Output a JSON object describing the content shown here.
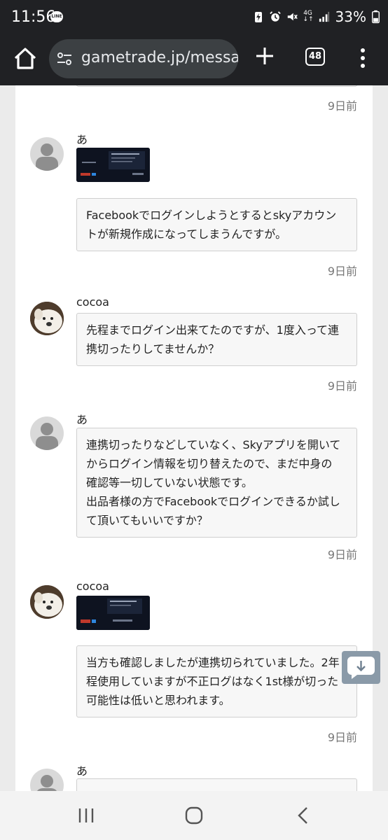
{
  "status_bar": {
    "time": "11:56",
    "line_badge": "LINE",
    "network": "4G",
    "battery": "33%",
    "icons": [
      "line-icon",
      "battery-saver-icon",
      "alarm-icon",
      "mute-icon",
      "signal-icon",
      "battery-icon"
    ]
  },
  "browser": {
    "url": "gametrade.jp/messa",
    "tab_count": "48",
    "icons": [
      "home-icon",
      "site-settings-icon",
      "new-tab-icon",
      "tab-switcher-icon",
      "more-menu-icon"
    ]
  },
  "messages": [
    {
      "sender": "",
      "avatar": "default-avatar-icon",
      "text_lines": [],
      "time": "9日前"
    },
    {
      "sender": "あ",
      "avatar": "default-avatar-icon",
      "image": true,
      "text_lines": [
        "Facebookでログインしようとするとskyアカウン",
        "トが新規作成になってしまうんですが。"
      ],
      "time": "9日前"
    },
    {
      "sender": "cocoa",
      "avatar": "dog-avatar",
      "text_lines": [
        "先程までログイン出来てたのですが、1度入って連",
        "携切ったりしてませんか？"
      ],
      "time": "9日前"
    },
    {
      "sender": "あ",
      "avatar": "default-avatar-icon",
      "text_lines": [
        "連携切ったりなどしていなく、Skyアプリを開いて",
        "からログイン情報を切り替えたので、まだ中身の",
        "確認等一切していない状態です。",
        "出品者様の方でFacebookでログインできるか試し",
        "て頂いてもいいですか？"
      ],
      "time": "9日前"
    },
    {
      "sender": "cocoa",
      "avatar": "dog-avatar",
      "image": true,
      "text_lines": [
        "当方も確認しましたが連携切られていました。2年",
        "程使用していますが不正ログはなく1st様が切った",
        "可能性は低いと思われます。"
      ],
      "time": "9日前"
    },
    {
      "sender": "あ",
      "avatar": "default-avatar-icon",
      "text_lines": [],
      "time": ""
    }
  ],
  "floating_button": {
    "icon": "scroll-down-chat-icon"
  },
  "nav_bar": {
    "icons": [
      "recent-apps-icon",
      "home-nav-icon",
      "back-icon"
    ]
  }
}
